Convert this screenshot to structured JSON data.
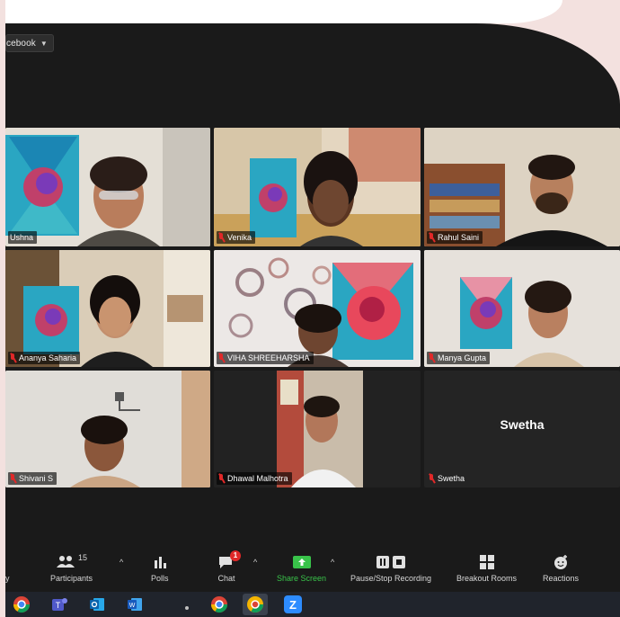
{
  "toolbar_top": {
    "view_label": "cebook"
  },
  "participants": [
    {
      "name": "Ushna",
      "muted": false,
      "active": true
    },
    {
      "name": "Venika",
      "muted": true,
      "active": false
    },
    {
      "name": "Rahul Saini",
      "muted": true,
      "active": false
    },
    {
      "name": "Ananya Saharia",
      "muted": true,
      "active": false
    },
    {
      "name": "VIHA SHREEHARSHA",
      "muted": true,
      "active": false
    },
    {
      "name": "Manya Gupta",
      "muted": true,
      "active": false
    },
    {
      "name": "Shivani S",
      "muted": true,
      "active": false
    },
    {
      "name": "Dhawal Malhotra",
      "muted": true,
      "active": false
    },
    {
      "name": "Swetha",
      "muted": true,
      "active": false,
      "display_name": "Swetha"
    }
  ],
  "controls": {
    "participants_label": "Participants",
    "participants_count": "15",
    "polls_label": "Polls",
    "chat_label": "Chat",
    "chat_badge": "1",
    "share_label": "Share Screen",
    "recording_label": "Pause/Stop Recording",
    "breakout_label": "Breakout Rooms",
    "reactions_label": "Reactions",
    "left_fragment": "y"
  },
  "colors": {
    "active_speaker": "#c8df52",
    "share_green": "#39c34a",
    "mute_red": "#e02828"
  },
  "taskbar": {
    "icons": [
      "chrome-icon",
      "teams-icon",
      "outlook-icon",
      "word-icon",
      "dot-icon",
      "chrome-icon",
      "chrome-canary-icon",
      "zoom-icon"
    ]
  }
}
